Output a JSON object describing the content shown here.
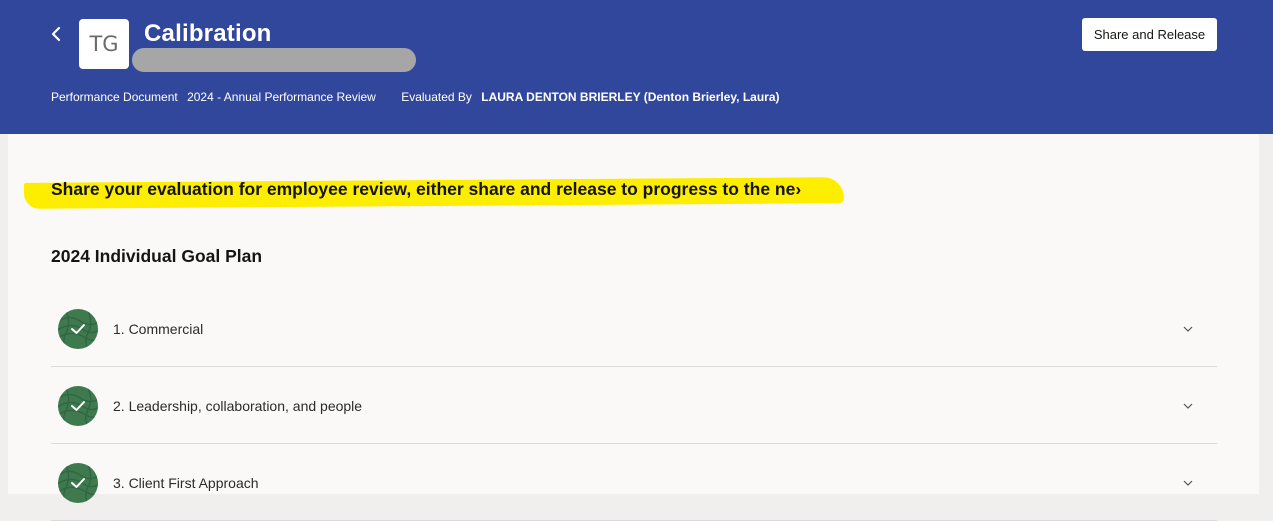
{
  "header": {
    "avatar_initials": "TG",
    "title": "Calibration",
    "share_release_label": "Share and Release",
    "performance_document_label": "Performance Document",
    "performance_document_value": "2024 - Annual Performance Review",
    "evaluated_by_label": "Evaluated By",
    "evaluated_by_value": "LAURA DENTON BRIERLEY (Denton Brierley, Laura)"
  },
  "main": {
    "instruction": "Share your evaluation for employee review, either share and release to progress to the ne›",
    "section_title": "2024 Individual Goal Plan",
    "goals": [
      {
        "label": "1. Commercial",
        "status_icon": "check-badge-icon"
      },
      {
        "label": "2. Leadership, collaboration, and people",
        "status_icon": "check-badge-icon"
      },
      {
        "label": "3. Client First Approach",
        "status_icon": "check-badge-icon"
      }
    ]
  },
  "colors": {
    "header_bg": "#31479c",
    "highlight": "#fdee00",
    "check_badge": "#3f7a4f",
    "card_bg": "#fbf9f8"
  }
}
